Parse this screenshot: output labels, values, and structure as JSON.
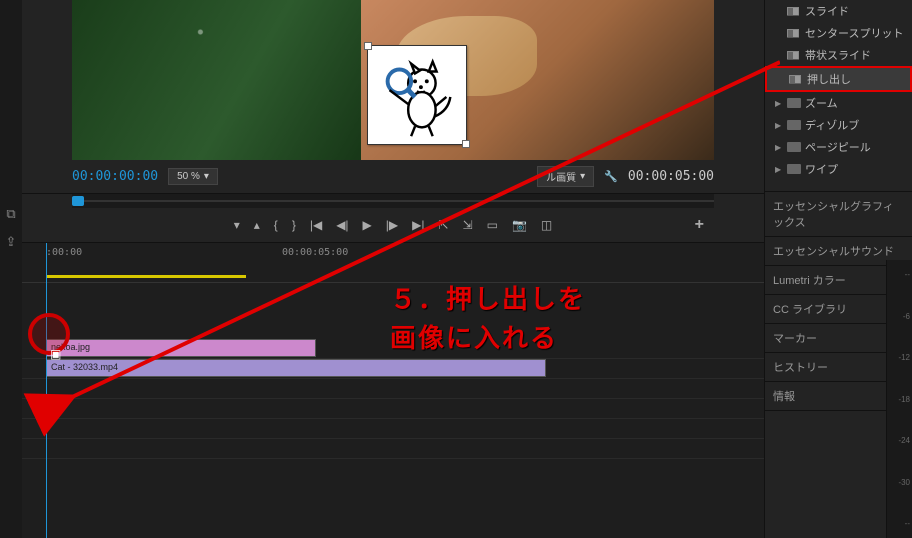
{
  "preview": {
    "timecode_start": "00:00:00:00",
    "timecode_end": "00:00:05:00",
    "zoom": "50 %",
    "quality": "ル画質"
  },
  "timeline": {
    "ruler": {
      "t0": ":00:00",
      "t1": "00:00:05:00"
    },
    "clips": {
      "v2": "nekoa.jpg",
      "v1": "Cat - 32033.mp4"
    }
  },
  "audio_meter": {
    "marks": [
      "--",
      "-6",
      "-12",
      "-18",
      "-24",
      "-30",
      "--"
    ]
  },
  "effects": {
    "items": [
      "スライド",
      "センタースプリット",
      "帯状スライド",
      "押し出し"
    ],
    "folders": [
      "ズーム",
      "ディゾルブ",
      "ページピール",
      "ワイプ"
    ]
  },
  "panels": [
    "エッセンシャルグラフィックス",
    "エッセンシャルサウンド",
    "Lumetri カラー",
    "CC ライブラリ",
    "マーカー",
    "ヒストリー",
    "情報"
  ],
  "annotation": {
    "line1": "５．押し出しを",
    "line2": "画像に入れる"
  }
}
